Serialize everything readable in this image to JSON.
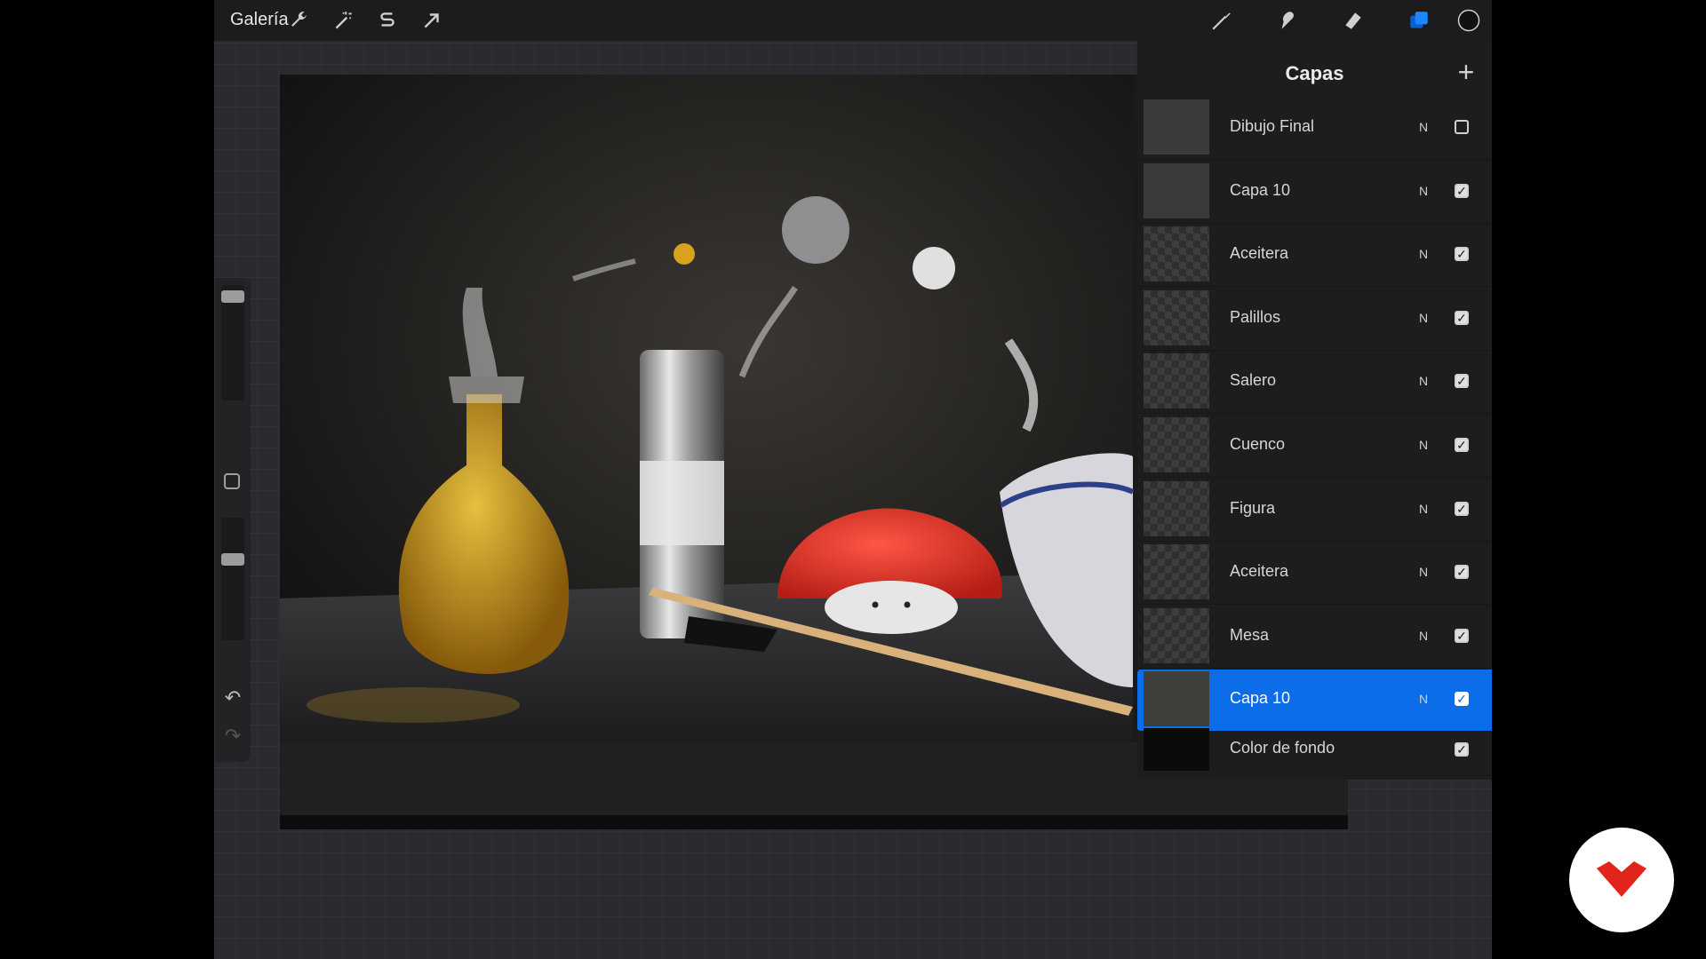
{
  "topbar": {
    "gallery_label": "Galería",
    "left_tools": [
      "wrench-icon",
      "magic-wand-icon",
      "selection-s-icon",
      "transform-arrow-icon"
    ],
    "right_tools": [
      "brush-icon",
      "smudge-icon",
      "eraser-icon",
      "layers-icon",
      "color-swatch-icon"
    ],
    "active_color": "#111111",
    "accent": "#0b6ee8"
  },
  "layers_panel": {
    "title": "Capas",
    "add_label": "+",
    "layers": [
      {
        "name": "Dibujo Final",
        "blend": "N",
        "visible": false,
        "selected": false
      },
      {
        "name": "Capa 10",
        "blend": "N",
        "visible": true,
        "selected": false
      },
      {
        "name": "Aceitera",
        "blend": "N",
        "visible": true,
        "selected": false
      },
      {
        "name": "Palillos",
        "blend": "N",
        "visible": true,
        "selected": false
      },
      {
        "name": "Salero",
        "blend": "N",
        "visible": true,
        "selected": false
      },
      {
        "name": "Cuenco",
        "blend": "N",
        "visible": true,
        "selected": false
      },
      {
        "name": "Figura",
        "blend": "N",
        "visible": true,
        "selected": false
      },
      {
        "name": "Aceitera",
        "blend": "N",
        "visible": true,
        "selected": false
      },
      {
        "name": "Mesa",
        "blend": "N",
        "visible": true,
        "selected": false
      },
      {
        "name": "Capa 10",
        "blend": "N",
        "visible": true,
        "selected": true
      },
      {
        "name": "Color de fondo",
        "blend": "",
        "visible": true,
        "selected": false
      }
    ]
  },
  "sidebar": {
    "undo_icon": "undo-icon",
    "redo_icon": "redo-icon",
    "brush_size_level": 0.9,
    "opacity_level": 0.7
  },
  "brand": {
    "logo_color": "#e1251b"
  }
}
